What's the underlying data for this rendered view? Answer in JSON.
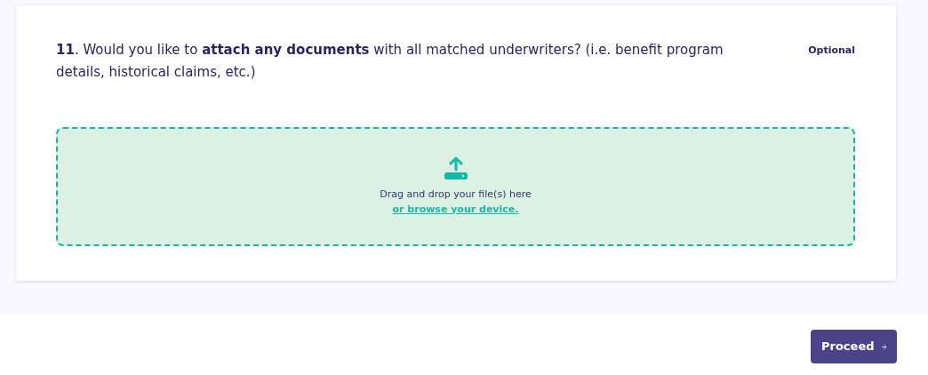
{
  "question": {
    "text": "**11**. Would you like to **attach any documents** with all matched underwriters? (i.e. benefit program details, historical claims, etc.)",
    "tag": "Optional"
  },
  "dropzone": {
    "prompt": "Drag and drop your file(s) here",
    "link": "or browse your device."
  },
  "buttons": [
    {
      "label": "Proceed",
      "kind": "primary"
    }
  ]
}
